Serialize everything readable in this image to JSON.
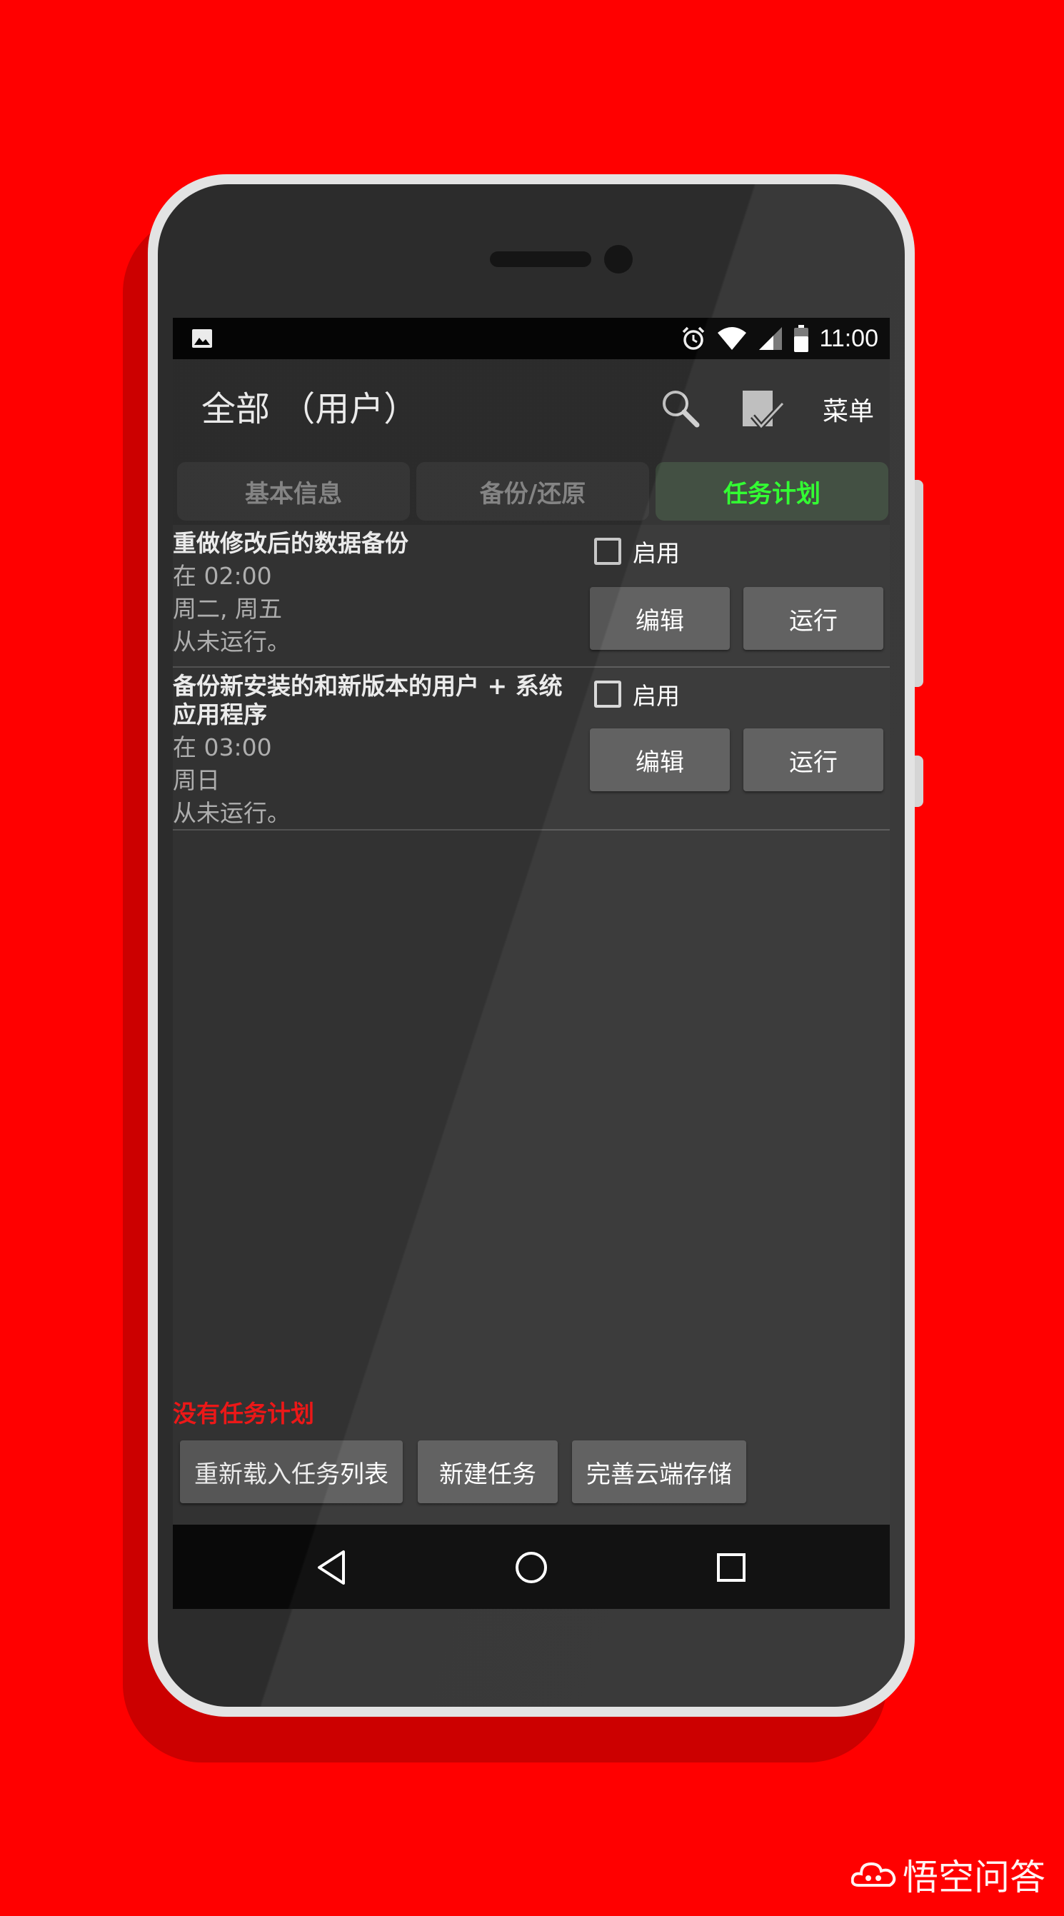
{
  "status_bar": {
    "time": "11:00",
    "icons": [
      "image-icon",
      "alarm-icon",
      "wifi-icon",
      "signal-icon",
      "battery-icon"
    ]
  },
  "app_bar": {
    "title": "全部 （用户）",
    "menu_label": "菜单",
    "icons": [
      "search-icon",
      "select-all-icon"
    ]
  },
  "tabs": [
    {
      "label": "基本信息",
      "active": false
    },
    {
      "label": "备份/还原",
      "active": false
    },
    {
      "label": "任务计划",
      "active": true
    }
  ],
  "tasks": [
    {
      "title": "重做修改后的数据备份",
      "time": "在 02:00",
      "days": "周二, 周五",
      "last_run": "从未运行。",
      "enable_label": "启用",
      "enabled": false,
      "edit_label": "编辑",
      "run_label": "运行"
    },
    {
      "title": "备份新安装的和新版本的用户 + 系统应用程序",
      "time": "在 03:00",
      "days": "周日",
      "last_run": "从未运行。",
      "enable_label": "启用",
      "enabled": false,
      "edit_label": "编辑",
      "run_label": "运行"
    }
  ],
  "footer": {
    "no_task_text": "没有任务计划",
    "buttons": [
      "重新载入任务列表",
      "新建任务",
      "完善云端存储"
    ]
  },
  "nav_bar": {
    "icons": [
      "back-icon",
      "home-icon",
      "recents-icon"
    ]
  },
  "watermark": {
    "text": "悟空问答"
  },
  "colors": {
    "background": "#ff0000",
    "active_tab_text": "#2cff2c",
    "no_task_text": "#ff1a1a",
    "button": "#5d5d5d"
  }
}
